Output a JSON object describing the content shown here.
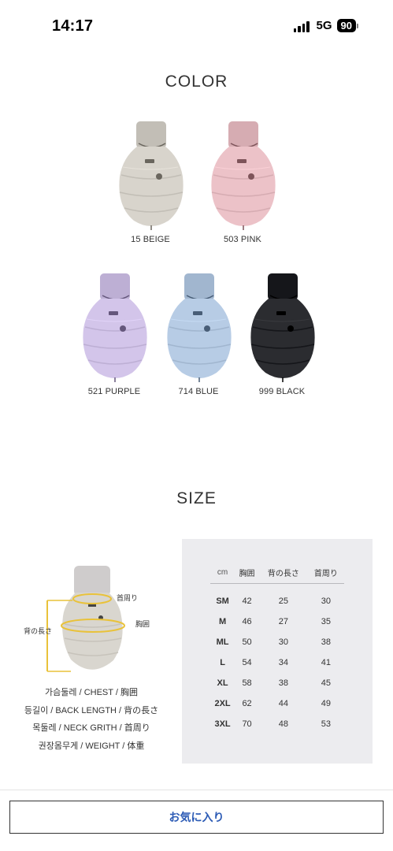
{
  "status_bar": {
    "time": "14:17",
    "network": "5G",
    "battery": "90"
  },
  "color_section": {
    "title": "COLOR",
    "products": [
      {
        "label": "15 BEIGE",
        "color": "#d8d4cc"
      },
      {
        "label": "503 PINK",
        "color": "#ecc2c8"
      },
      {
        "label": "521 PURPLE",
        "color": "#d3c5ea"
      },
      {
        "label": "714 BLUE",
        "color": "#b7cce5"
      },
      {
        "label": "999 BLACK",
        "color": "#2b2c30"
      }
    ]
  },
  "size_section": {
    "title": "SIZE",
    "illustration_labels": {
      "neck": "首周り",
      "back": "背の長さ",
      "chest": "胸囲"
    },
    "measurements": [
      "가슴둘레 / CHEST / 胸囲",
      "등길이 / BACK LENGTH / 背の長さ",
      "목둘레 / NECK GRITH / 首周り",
      "권장몸무게 / WEIGHT / 体重"
    ],
    "table": {
      "headers": [
        "cm",
        "胸囲",
        "背の長さ",
        "首周り"
      ],
      "rows": [
        [
          "SM",
          "42",
          "25",
          "30"
        ],
        [
          "M",
          "46",
          "27",
          "35"
        ],
        [
          "ML",
          "50",
          "30",
          "38"
        ],
        [
          "L",
          "54",
          "34",
          "41"
        ],
        [
          "XL",
          "58",
          "38",
          "45"
        ],
        [
          "2XL",
          "62",
          "44",
          "49"
        ],
        [
          "3XL",
          "70",
          "48",
          "53"
        ]
      ]
    }
  },
  "footer": {
    "favorite_button": "お気に入り"
  }
}
